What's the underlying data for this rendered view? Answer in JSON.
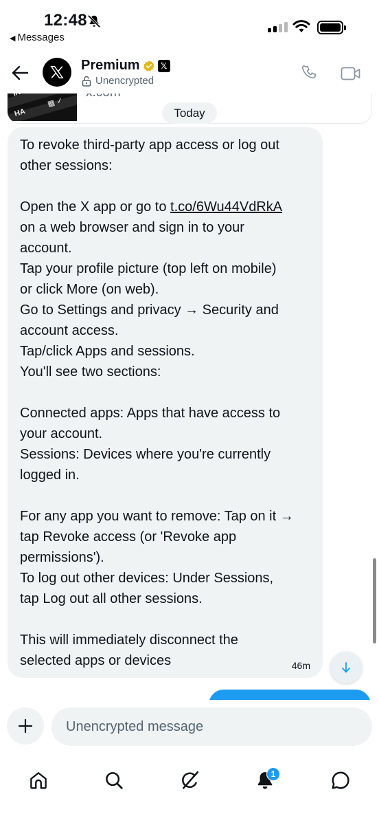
{
  "status_bar": {
    "time": "12:48",
    "back_app": "Messages"
  },
  "header": {
    "title": "Premium",
    "encryption_status": "Unencrypted"
  },
  "previous_card": {
    "domain": "x.com"
  },
  "date_separator": "Today",
  "message": {
    "lines": [
      "To revoke third-party app access or log out",
      "other sessions:",
      "",
      "",
      "on a web browser and sign in to your",
      "account.",
      "Tap your profile picture (top left on mobile)",
      "or click More (on web).",
      "Go to Settings and privacy → Security and",
      "account access.",
      "Tap/click Apps and sessions.",
      "You'll see two sections:",
      "",
      "Connected apps: Apps that have access to",
      "your account.",
      "Sessions: Devices where you're currently",
      "logged in.",
      "",
      "For any app you want to remove: Tap on it →",
      "tap Revoke access (or 'Revoke app",
      "permissions').",
      "To log out other devices: Under Sessions,",
      "tap Log out all other sessions.",
      "",
      "This will immediately disconnect the",
      "selected apps or devices"
    ],
    "link_line_prefix": "Open the X app or go to ",
    "link_text": "t.co/6Wu44VdRkA",
    "timestamp": "46m"
  },
  "composer": {
    "placeholder": "Unencrypted message"
  },
  "nav": {
    "notifications_count": "1"
  },
  "colors": {
    "accent": "#1d9bf0",
    "bubble_bg": "#eff3f4",
    "verified_gold": "#e2b719"
  },
  "icons": {
    "status": [
      "bell-off-icon",
      "signal-icon",
      "wifi-icon",
      "battery-icon"
    ],
    "header": [
      "back-arrow-icon",
      "x-logo-icon",
      "verified-badge-icon",
      "x-affiliate-badge-icon",
      "lock-open-icon",
      "phone-icon",
      "video-icon"
    ],
    "nav": [
      "home-icon",
      "search-icon",
      "grok-icon",
      "bell-icon",
      "messages-icon"
    ]
  }
}
